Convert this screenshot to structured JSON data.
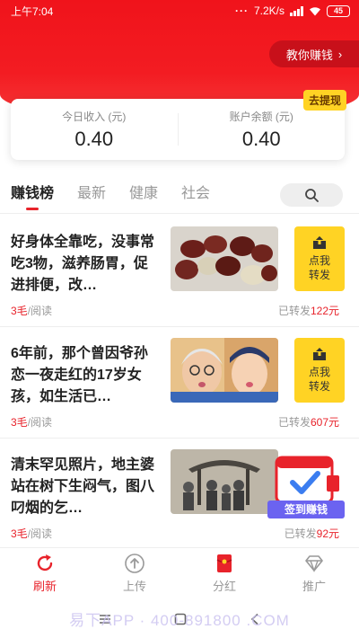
{
  "status_bar": {
    "time": "上午7:04",
    "dots": "···",
    "speed": "7.2K/s",
    "battery": "45"
  },
  "header": {
    "teach_label": "教你赚钱",
    "teach_arrow": "›"
  },
  "income": {
    "today_label": "今日收入 (元)",
    "today_value": "0.40",
    "balance_label": "账户余额 (元)",
    "balance_value": "0.40",
    "withdraw_label": "去提现"
  },
  "tabs": [
    {
      "label": "赚钱榜",
      "active": true
    },
    {
      "label": "最新"
    },
    {
      "label": "健康"
    },
    {
      "label": "社会"
    }
  ],
  "articles": [
    {
      "title": "好身体全靠吃，没事常吃3物，滋养肠胃，促进排便，改…",
      "price": "3毛",
      "per_read": "/阅读",
      "shares_prefix": "已转发",
      "shares": "122元",
      "share_btn": [
        "点我",
        "转发"
      ]
    },
    {
      "title": "6年前，那个曾因爷孙恋一夜走红的17岁女孩，如生活已…",
      "price": "3毛",
      "per_read": "/阅读",
      "shares_prefix": "已转发",
      "shares": "607元",
      "share_btn": [
        "点我",
        "转发"
      ]
    },
    {
      "title": "清末罕见照片，地主婆站在树下生闷气，图八叼烟的乞…",
      "price": "3毛",
      "per_read": "/阅读",
      "shares_prefix": "已转发",
      "shares": "92元"
    }
  ],
  "sign_badge": {
    "label": "签到赚钱"
  },
  "nav": [
    {
      "label": "刷新",
      "icon": "refresh-icon",
      "active": true
    },
    {
      "label": "上传",
      "icon": "upload-icon"
    },
    {
      "label": "分红",
      "icon": "red-envelope-icon"
    },
    {
      "label": "推广",
      "icon": "diamond-icon"
    }
  ],
  "watermark": "易下APP · 400-891800 .COM",
  "colors": {
    "brand_red": "#e8232b",
    "accent_yellow": "#ffd324",
    "badge_purple": "#6b63f0"
  }
}
